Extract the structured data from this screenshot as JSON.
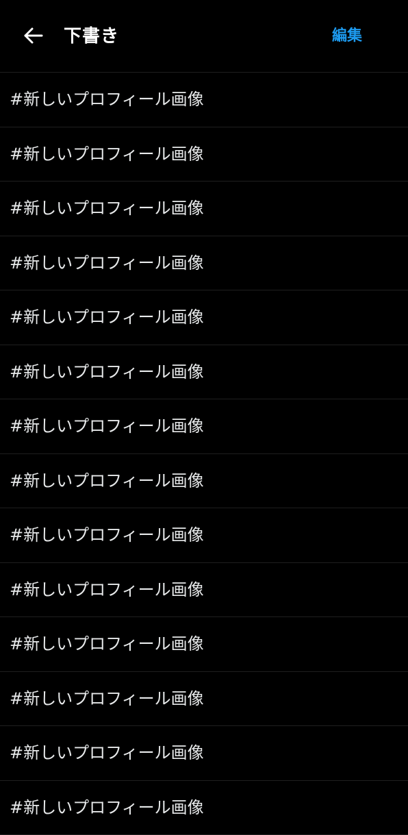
{
  "header": {
    "back_icon": "arrow-left-icon",
    "title": "下書き",
    "edit_label": "編集",
    "accent_color": "#1d9bf0"
  },
  "drafts": [
    {
      "text": "#新しいプロフィール画像"
    },
    {
      "text": "#新しいプロフィール画像"
    },
    {
      "text": "#新しいプロフィール画像"
    },
    {
      "text": "#新しいプロフィール画像"
    },
    {
      "text": "#新しいプロフィール画像"
    },
    {
      "text": "#新しいプロフィール画像"
    },
    {
      "text": "#新しいプロフィール画像"
    },
    {
      "text": "#新しいプロフィール画像"
    },
    {
      "text": "#新しいプロフィール画像"
    },
    {
      "text": "#新しいプロフィール画像"
    },
    {
      "text": "#新しいプロフィール画像"
    },
    {
      "text": "#新しいプロフィール画像"
    },
    {
      "text": "#新しいプロフィール画像"
    },
    {
      "text": "#新しいプロフィール画像"
    }
  ]
}
